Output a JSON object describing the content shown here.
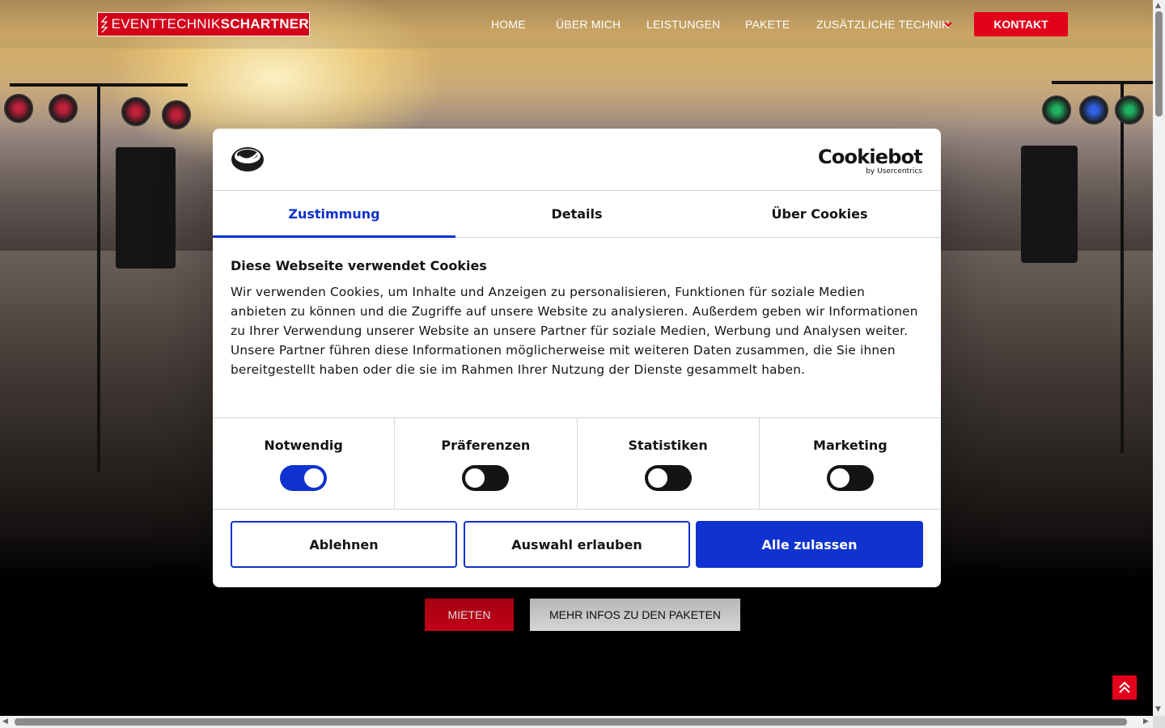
{
  "navbar": {
    "logo": {
      "light": "EVENTTECHNIK",
      "bold": "SCHARTNER"
    },
    "items": [
      "HOME",
      "ÜBER MICH",
      "LEISTUNGEN",
      "PAKETE",
      "ZUSÄTZLICHE TECHNIK"
    ],
    "contact_label": "KONTAKT"
  },
  "hero": {
    "rent_label": "MIETEN",
    "packages_label": "MEHR INFOS ZU DEN PAKETEN"
  },
  "cookie_dialog": {
    "brand": {
      "name": "Cookiebot",
      "byline": "by Usercentrics"
    },
    "tabs": [
      {
        "label": "Zustimmung",
        "active": true
      },
      {
        "label": "Details",
        "active": false
      },
      {
        "label": "Über Cookies",
        "active": false
      }
    ],
    "heading": "Diese Webseite verwendet Cookies",
    "body": "Wir verwenden Cookies, um Inhalte und Anzeigen zu personalisieren, Funktionen für soziale Medien anbieten zu können und die Zugriffe auf unsere Website zu analysieren. Außerdem geben wir Informationen zu Ihrer Verwendung unserer Website an unsere Partner für soziale Medien, Werbung und Analysen weiter. Unsere Partner führen diese Informationen möglicherweise mit weiteren Daten zusammen, die Sie ihnen bereitgestellt haben oder die sie im Rahmen Ihrer Nutzung der Dienste gesammelt haben.",
    "categories": [
      {
        "label": "Notwendig",
        "enabled": true
      },
      {
        "label": "Präferenzen",
        "enabled": false
      },
      {
        "label": "Statistiken",
        "enabled": false
      },
      {
        "label": "Marketing",
        "enabled": false
      }
    ],
    "buttons": {
      "decline": "Ablehnen",
      "allow_selection": "Auswahl erlauben",
      "allow_all": "Alle zulassen"
    }
  },
  "colors": {
    "brand_red": "#e3001b",
    "cookiebot_blue": "#1032cf",
    "text_dark": "#141414"
  }
}
